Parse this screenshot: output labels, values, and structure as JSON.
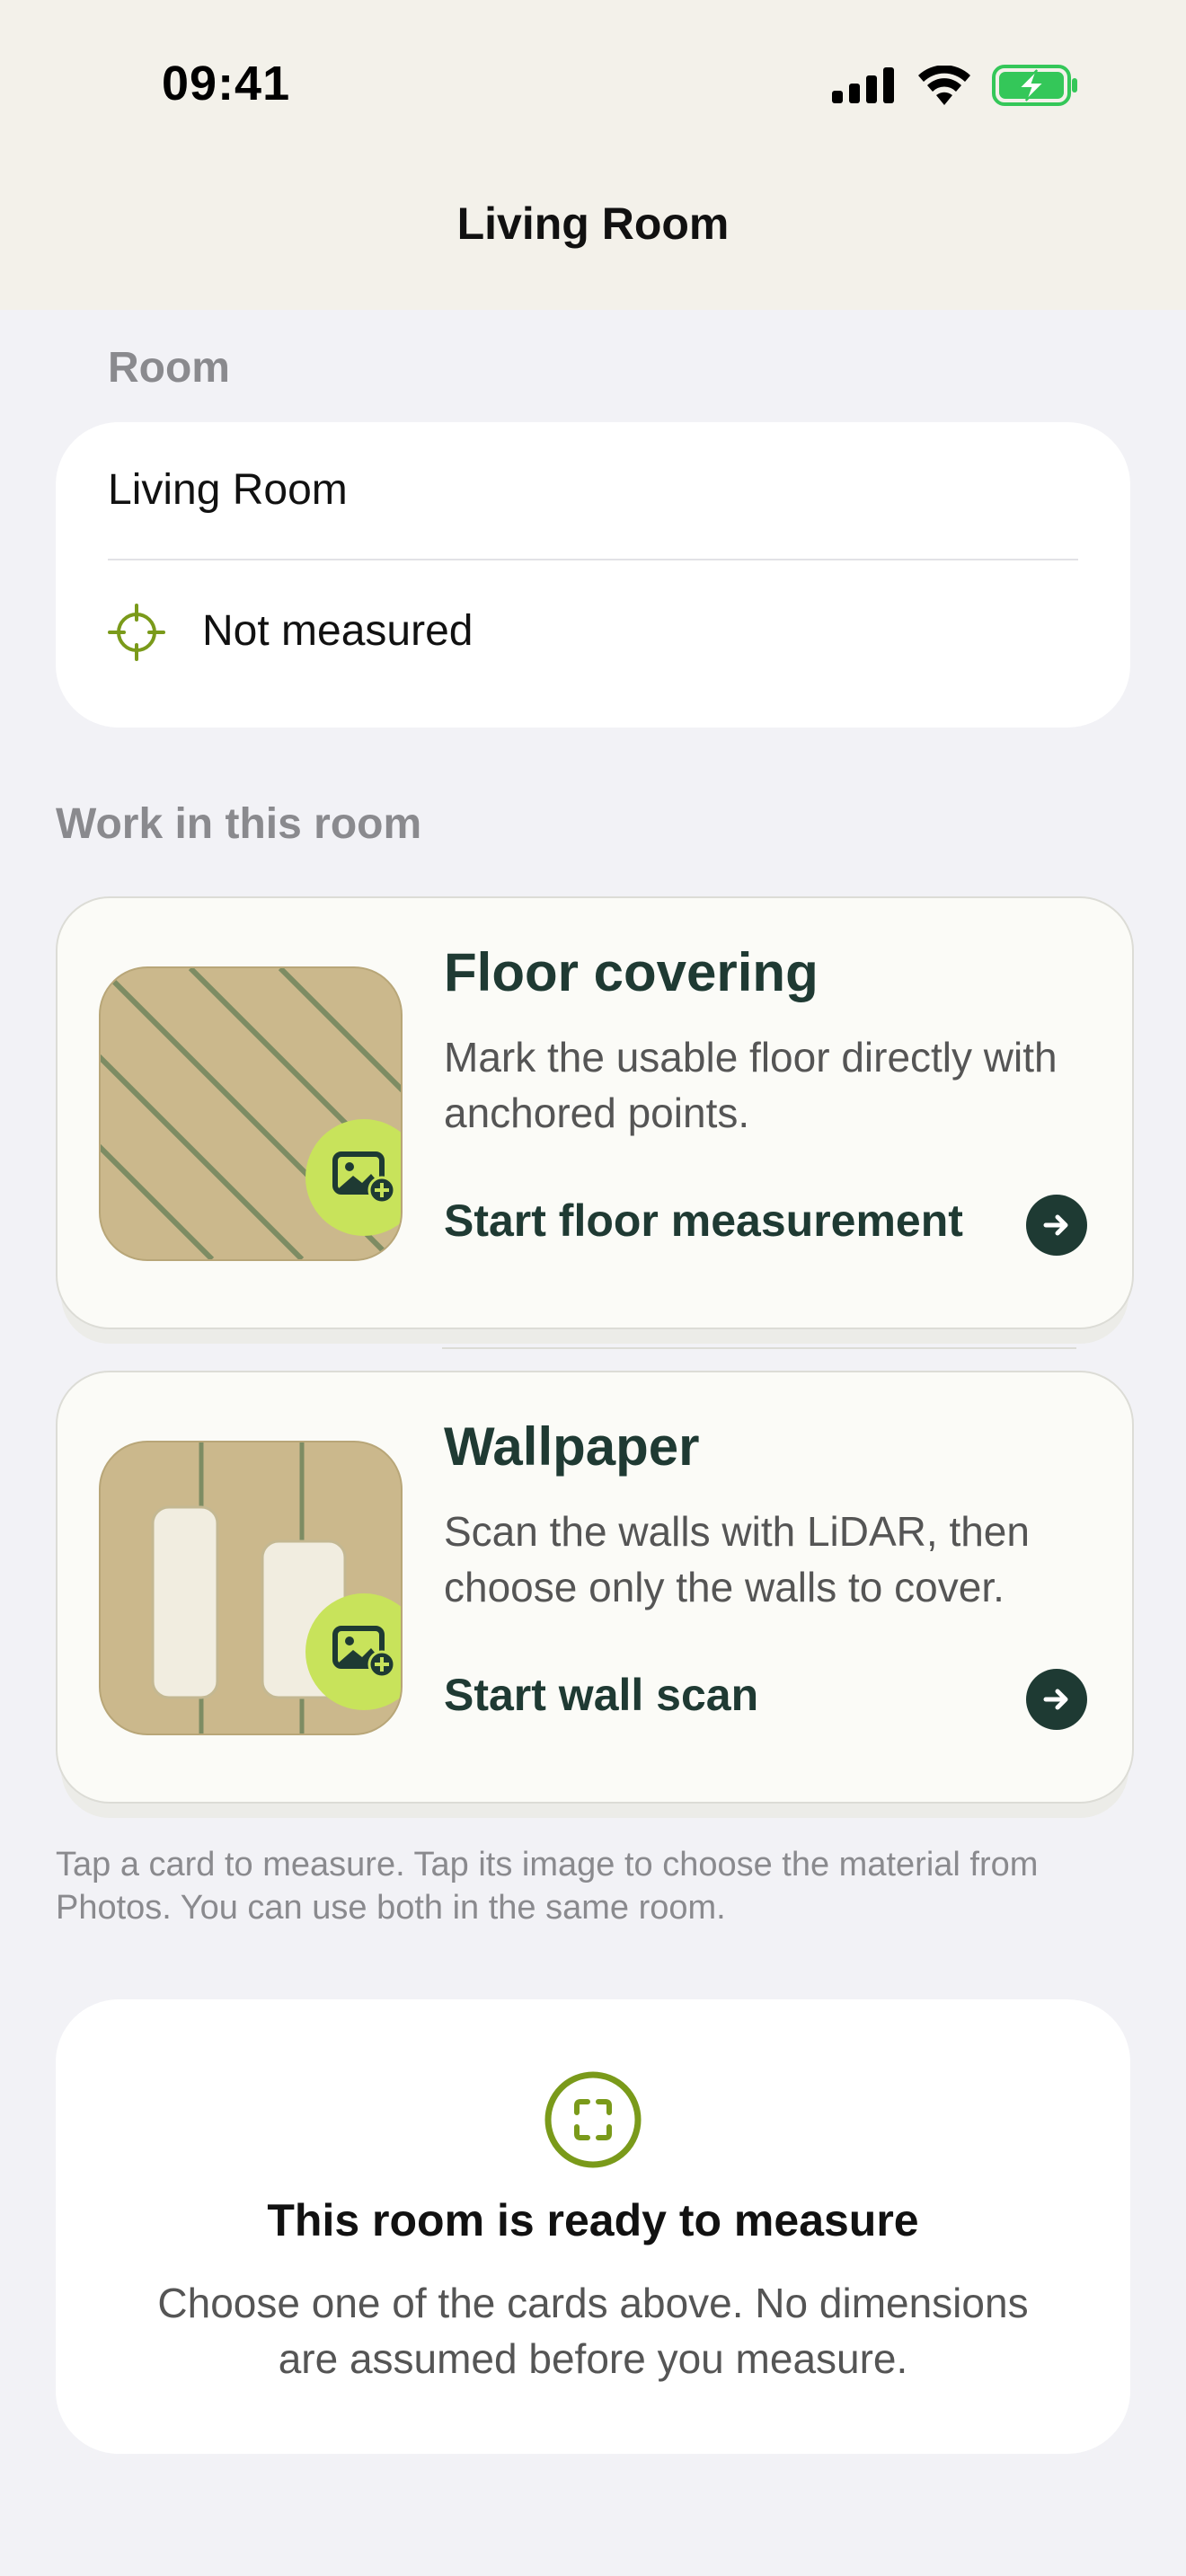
{
  "status_bar": {
    "time": "09:41"
  },
  "nav": {
    "title": "Living Room"
  },
  "room_section": {
    "label": "Room",
    "name": "Living Room",
    "status": "Not measured"
  },
  "work_section": {
    "label": "Work in this room",
    "cards": [
      {
        "title": "Floor covering",
        "description": "Mark the usable floor directly with anchored points.",
        "action": "Start floor measurement",
        "thumb_icon": "photo-add-icon"
      },
      {
        "title": "Wallpaper",
        "description": "Scan the walls with LiDAR, then choose only the walls to cover.",
        "action": "Start wall scan",
        "thumb_icon": "photo-add-icon"
      }
    ],
    "hint": "Tap a card to measure. Tap its image to choose the material from Photos. You can use both in the same room."
  },
  "ready_panel": {
    "title": "This room is ready to measure",
    "description": "Choose one of the cards above. No dimensions are assumed before you measure.",
    "icon": "scan-frame-icon"
  },
  "colors": {
    "accent_green": "#c8e35b",
    "dark_green": "#1e3a33",
    "icon_green": "#7a9a1a"
  }
}
